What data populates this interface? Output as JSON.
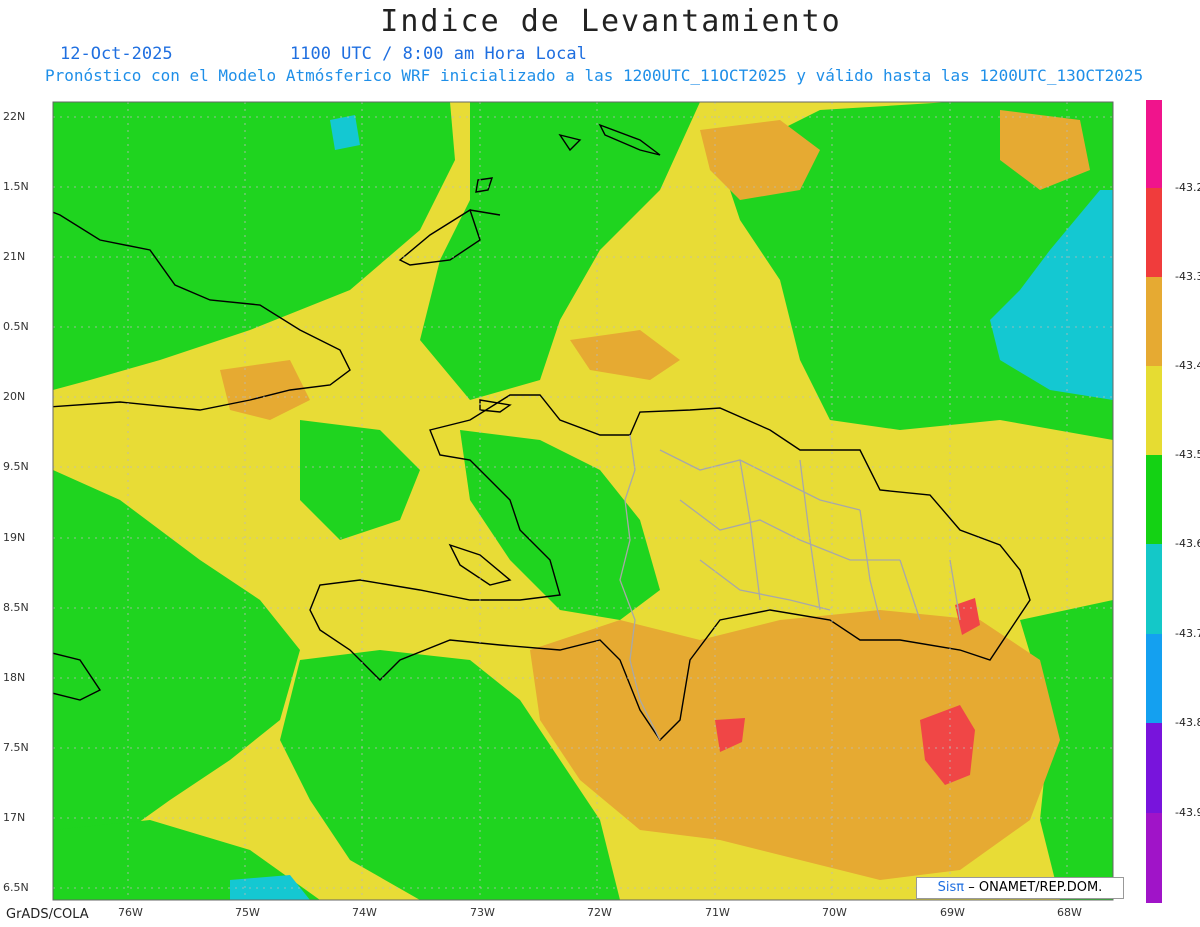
{
  "title": "Indice de Levantamiento",
  "date": "12-Oct-2025",
  "time": "1100 UTC / 8:00 am Hora Local",
  "subtitle": "Pronóstico con el Modelo Atmósferico WRF inicializado a las 1200UTC_11OCT2025 y válido hasta las  1200UTC_13OCT2025",
  "footer_left": "GrADS/COLA",
  "credit": {
    "logo": "Sisπ",
    "text": "– ONAMET/REP.DOM."
  },
  "lat_labels": [
    "22N",
    "1.5N",
    "21N",
    "0.5N",
    "20N",
    "9.5N",
    "19N",
    "8.5N",
    "18N",
    "7.5N",
    "17N",
    "6.5N"
  ],
  "lon_labels": [
    "76W",
    "75W",
    "74W",
    "73W",
    "72W",
    "71W",
    "70W",
    "69W",
    "68W"
  ],
  "colorbar": {
    "labels": [
      "-43.2",
      "-43.3",
      "-43.4",
      "-43.5",
      "-43.6",
      "-43.7",
      "-43.8",
      "-43.9"
    ],
    "colors": [
      "#f0148c",
      "#f03c3c",
      "#e6aa32",
      "#e6dc32",
      "#14d214",
      "#14c8c8",
      "#14a0f0",
      "#7814dc",
      "#a014c8"
    ]
  },
  "field_colors": {
    "green": "#1fd41f",
    "yellow": "#e8dc36",
    "orange": "#e6aa32",
    "red": "#f04646",
    "cyan": "#14c8d2",
    "magenta": "#f0148c",
    "blue": "#1878f0"
  }
}
